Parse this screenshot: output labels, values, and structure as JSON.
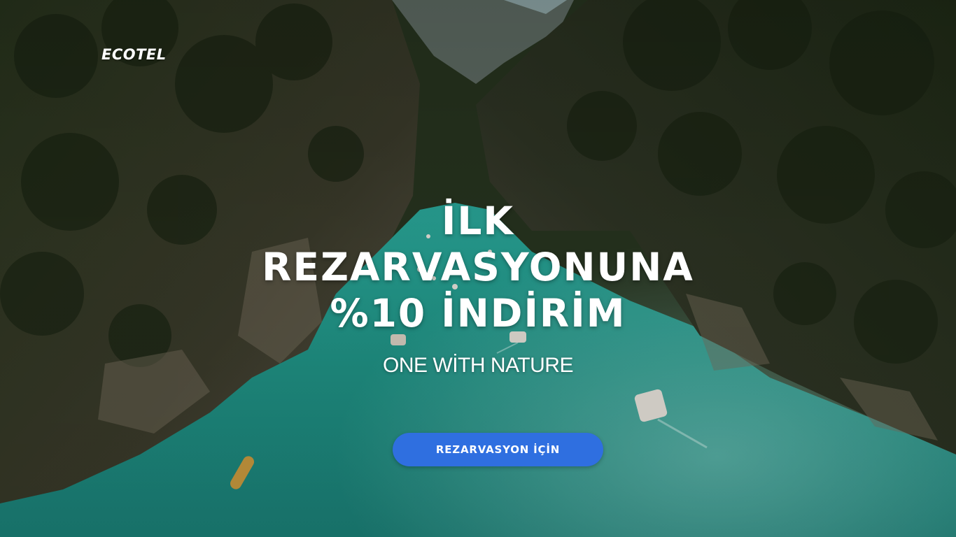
{
  "brand": {
    "logo_text": "ECOTEL"
  },
  "hero": {
    "headline_lines": [
      "İLK",
      "REZARVASYONUNA",
      "%10 İNDİRİM"
    ],
    "tagline": "ONE WİTH NATURE",
    "cta_label": "REZARVASYON İÇİN",
    "background_image": "aerial-river-canyon-with-kayaks"
  },
  "colors": {
    "cta_background": "#2f6fe0",
    "text": "#ffffff",
    "water": "#1f8f84",
    "foliage": "#1e2a15"
  }
}
